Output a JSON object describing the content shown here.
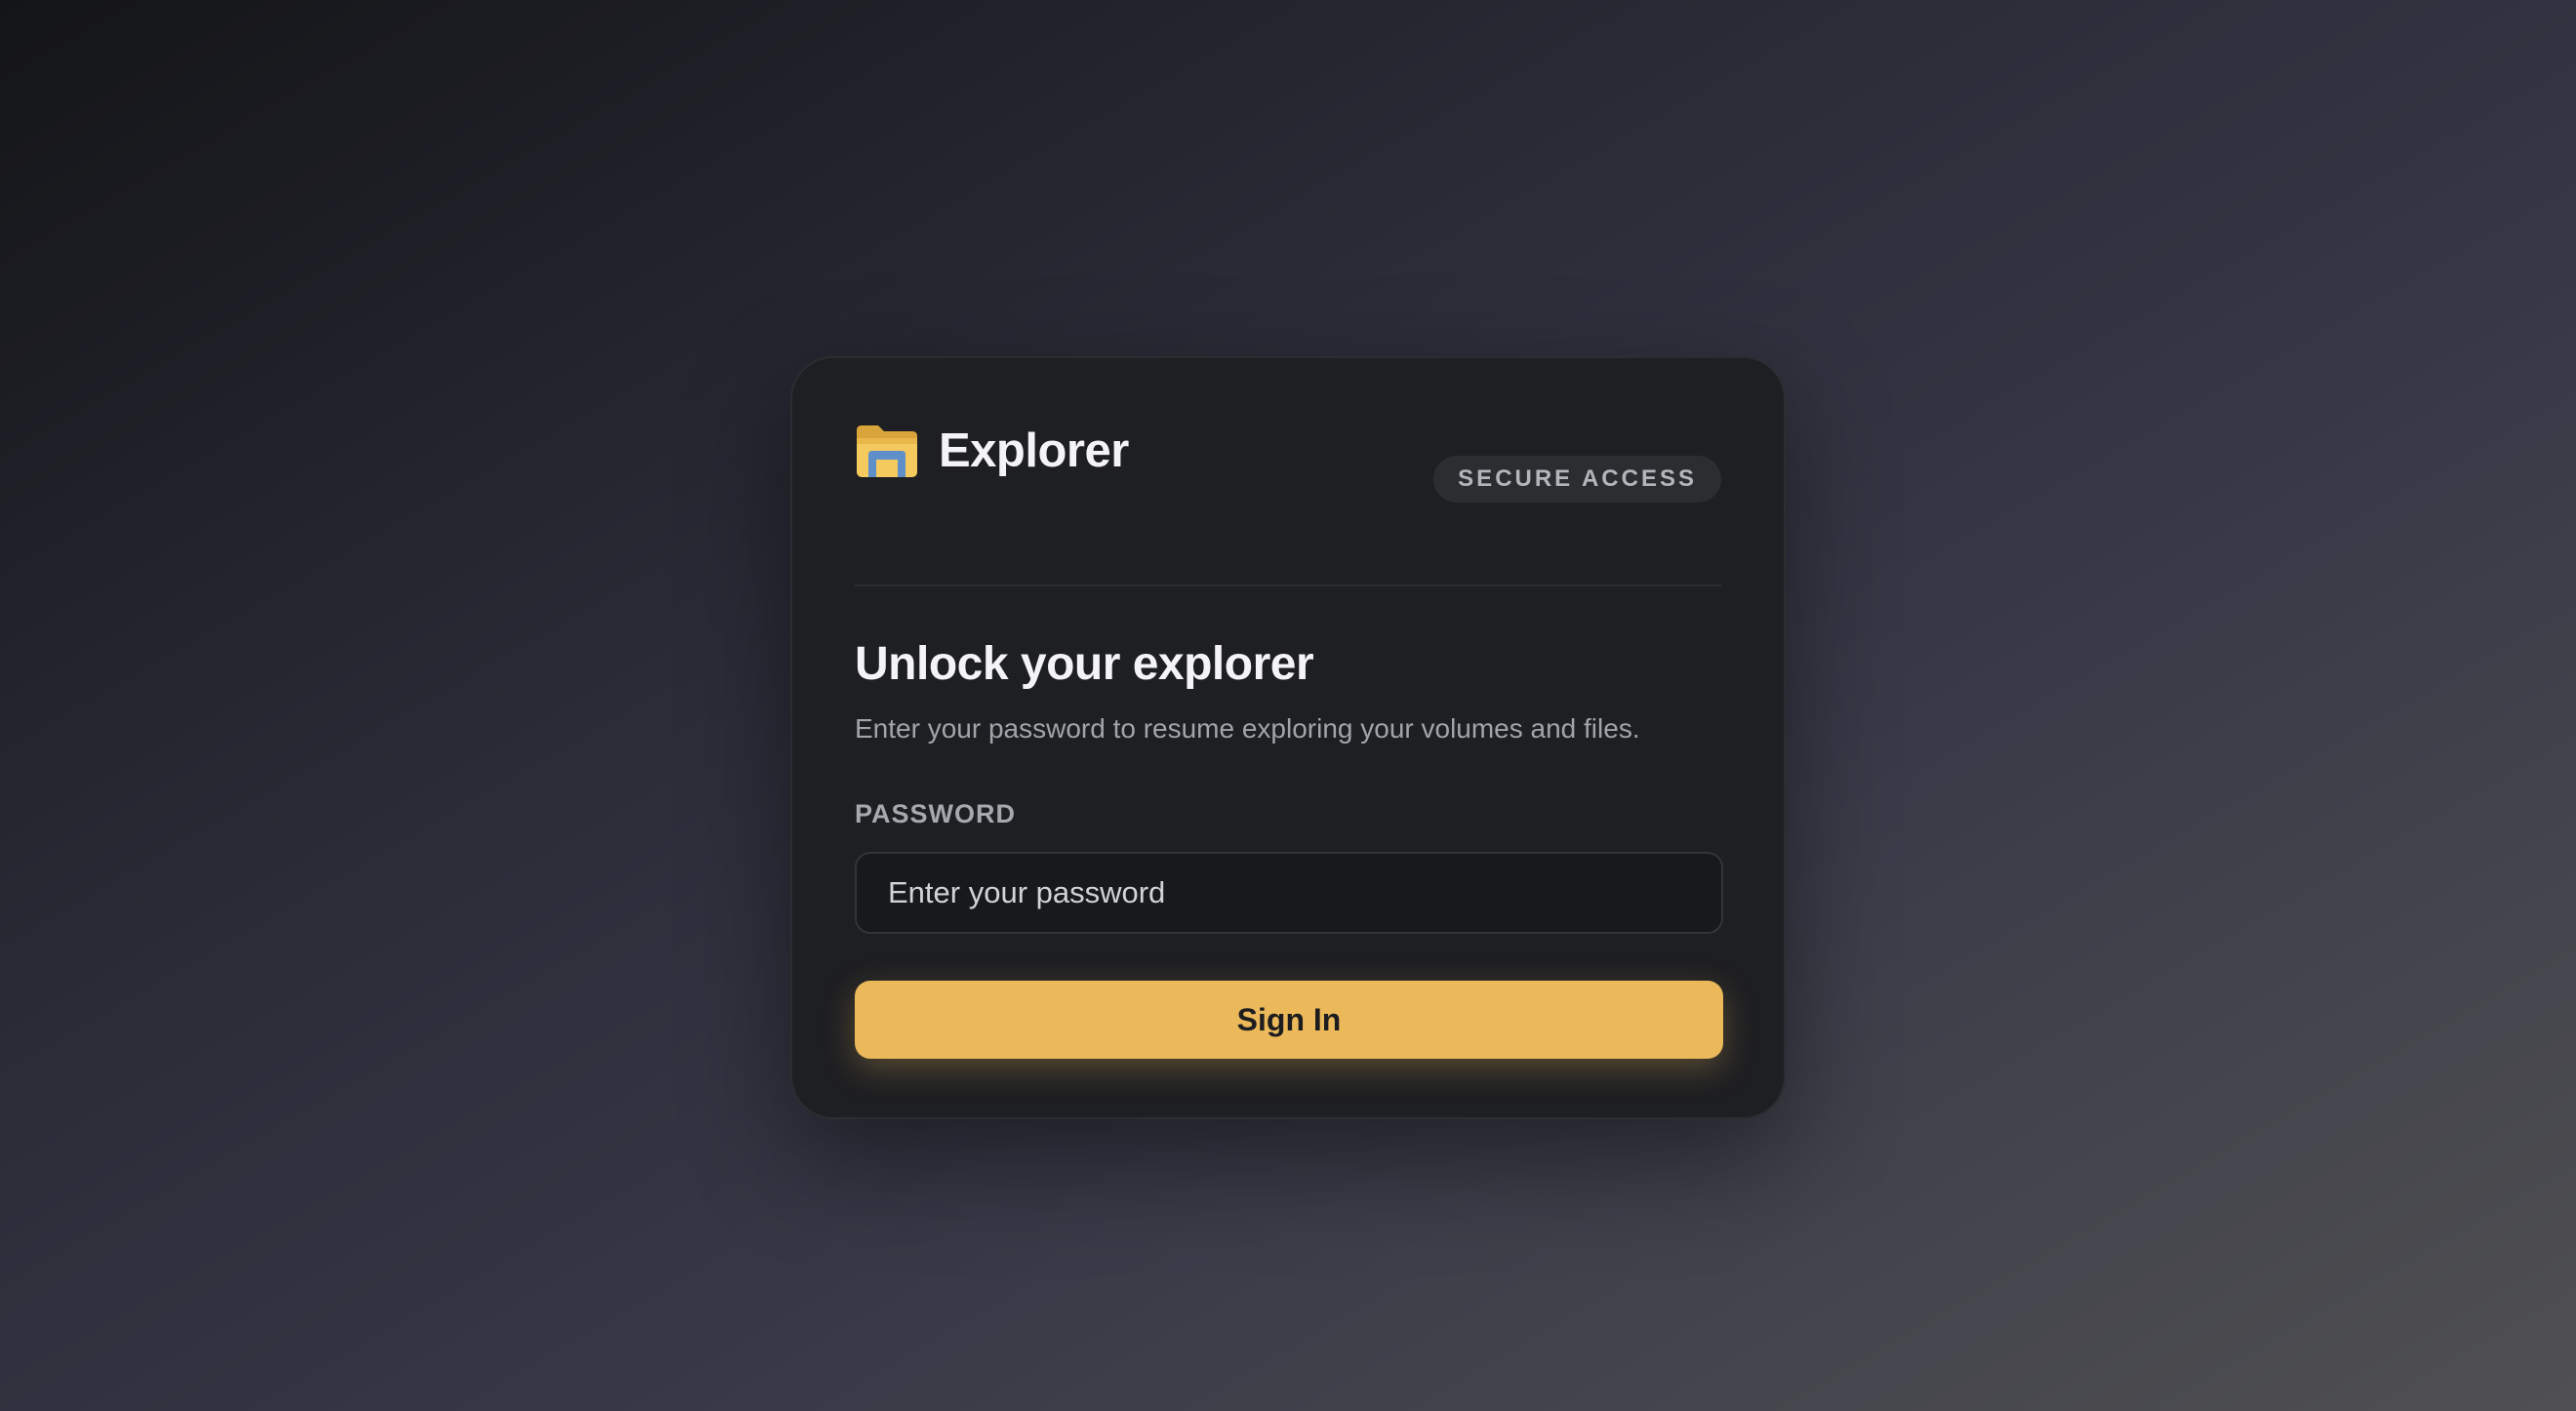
{
  "brand": {
    "icon": "folder-icon",
    "name": "Explorer"
  },
  "badge": {
    "label": "SECURE ACCESS"
  },
  "login": {
    "heading": "Unlock your explorer",
    "subtext": "Enter your password to resume exploring your volumes and files.",
    "password_label": "PASSWORD",
    "password_placeholder": "Enter your password",
    "password_value": "",
    "submit_label": "Sign In"
  },
  "colors": {
    "accent": "#ebb95a",
    "card_background": "#1e1f22",
    "text_primary": "#f4f4f6",
    "text_secondary": "#a3a4aa"
  }
}
